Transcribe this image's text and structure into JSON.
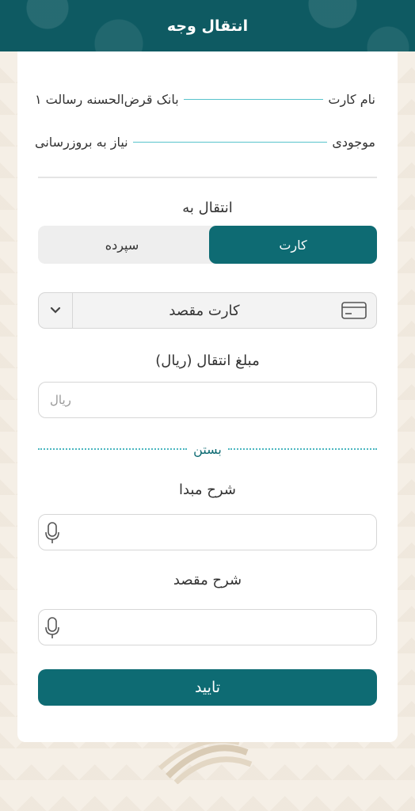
{
  "header": {
    "title": "انتقال وجه"
  },
  "info": {
    "card_name_label": "نام کارت",
    "card_name_value": "بانک قرض‌الحسنه رسالت ۱",
    "balance_label": "موجودی",
    "balance_value": "نیاز به بروزرسانی"
  },
  "transfer_to": {
    "label": "انتقال به",
    "options": [
      "کارت",
      "سپرده"
    ],
    "selected": "کارت"
  },
  "destination_card": {
    "label": "کارت مقصد",
    "icon": "credit-card-icon"
  },
  "amount": {
    "label": "مبلغ انتقال (ریال)",
    "placeholder": "ریال",
    "value": ""
  },
  "collapse": {
    "label": "بستن"
  },
  "source_description": {
    "label": "شرح مبدا",
    "value": "",
    "icon": "microphone-icon"
  },
  "target_description": {
    "label": "شرح مقصد",
    "value": "",
    "icon": "microphone-icon"
  },
  "submit": {
    "label": "تایید"
  },
  "colors": {
    "primary": "#0e6b73",
    "accent_line": "#58c3cc",
    "background": "#f5efe6"
  }
}
